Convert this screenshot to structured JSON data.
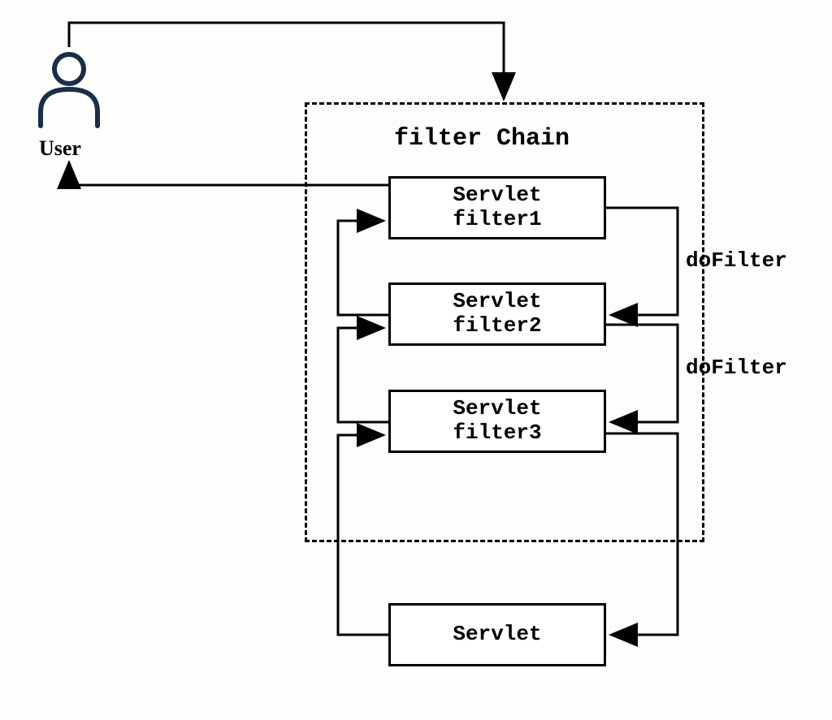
{
  "user": {
    "label": "User"
  },
  "filterChain": {
    "title": "filter Chain"
  },
  "boxes": {
    "filter1": {
      "line1": "Servlet",
      "line2": "filter1"
    },
    "filter2": {
      "line1": "Servlet",
      "line2": "filter2"
    },
    "filter3": {
      "line1": "Servlet",
      "line2": "filter3"
    },
    "servlet": {
      "label": "Servlet"
    }
  },
  "labels": {
    "doFilter1": "doFilter",
    "doFilter2": "doFilter"
  }
}
